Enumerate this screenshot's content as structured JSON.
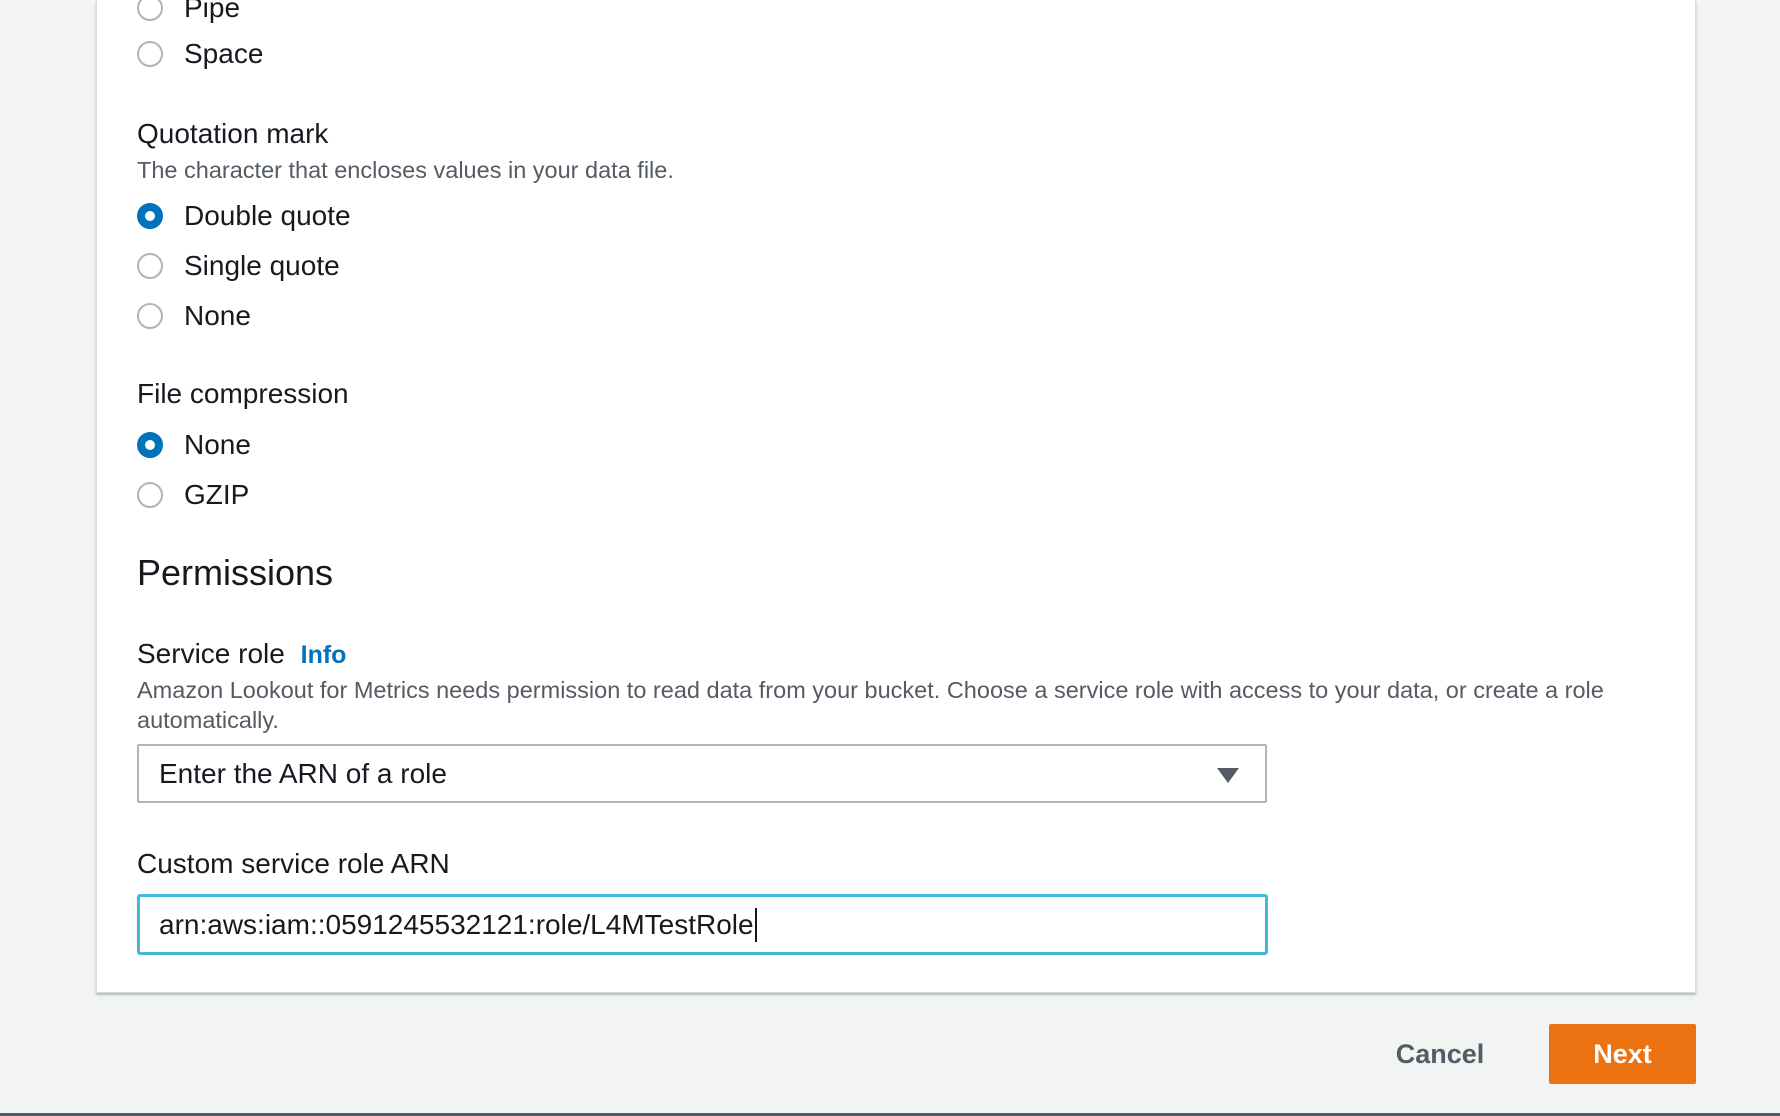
{
  "delimiter": {
    "options": [
      {
        "label": "Pipe",
        "checked": false
      },
      {
        "label": "Space",
        "checked": false
      }
    ]
  },
  "quotation": {
    "label": "Quotation mark",
    "description": "The character that encloses values in your data file.",
    "options": [
      {
        "label": "Double quote",
        "checked": true
      },
      {
        "label": "Single quote",
        "checked": false
      },
      {
        "label": "None",
        "checked": false
      }
    ]
  },
  "compression": {
    "label": "File compression",
    "options": [
      {
        "label": "None",
        "checked": true
      },
      {
        "label": "GZIP",
        "checked": false
      }
    ]
  },
  "permissions": {
    "title": "Permissions",
    "service_role": {
      "label": "Service role",
      "info_link": "Info",
      "description": "Amazon Lookout for Metrics needs permission to read data from your bucket. Choose a service role with access to your data, or create a role automatically.",
      "selected": "Enter the ARN of a role"
    },
    "custom_arn": {
      "label": "Custom service role ARN",
      "value": "arn:aws:iam::0591245532121:role/L4MTestRole"
    }
  },
  "footer": {
    "cancel_label": "Cancel",
    "next_label": "Next"
  },
  "colors": {
    "accent": "#0073bb",
    "primary_button": "#ec7211",
    "focus_ring": "#44b9d6"
  }
}
